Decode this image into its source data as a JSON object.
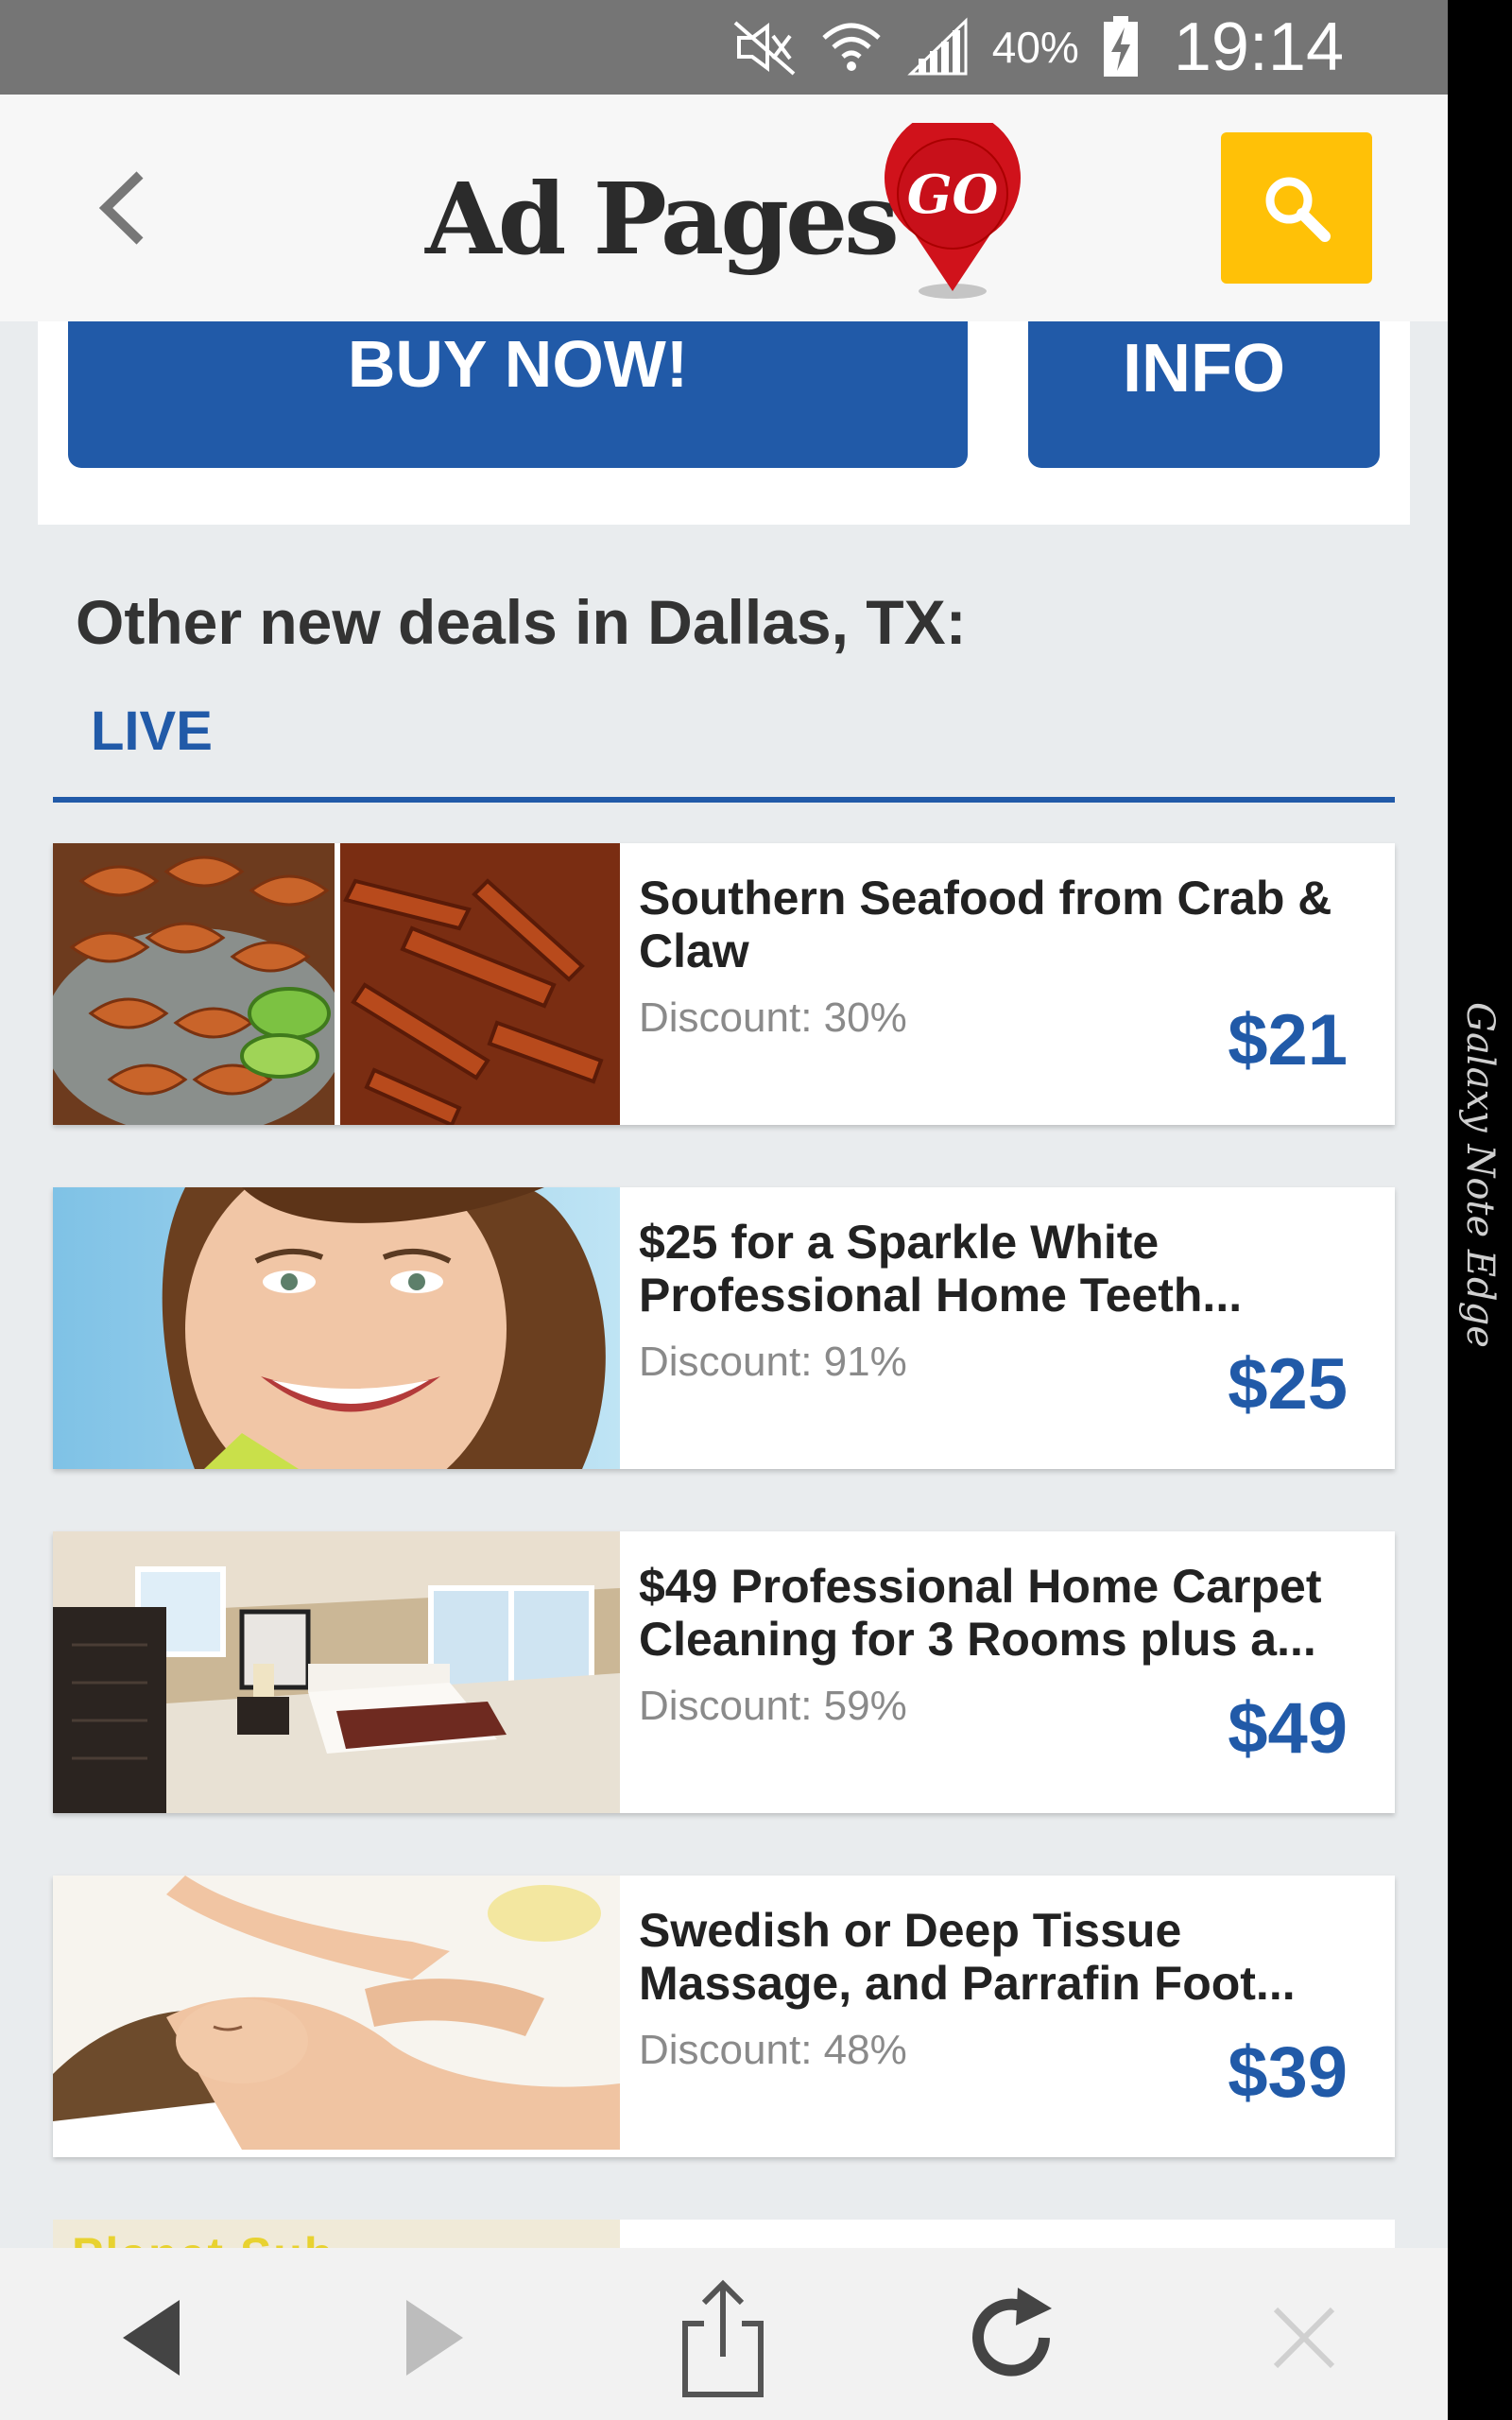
{
  "status_bar": {
    "battery_percent": "40%",
    "time": "19:14",
    "icons": [
      "mute-icon",
      "wifi-icon",
      "signal-icon",
      "battery-charging-icon"
    ]
  },
  "header": {
    "back_icon": "chevron-left-icon",
    "logo_text": "Ad Pages",
    "logo_badge": "GO",
    "search_icon": "search-icon",
    "search_button_color": "#ffc107"
  },
  "top_card": {
    "buy_label": "BUY NOW!",
    "info_label": "INFO"
  },
  "section": {
    "title": "Other new deals in Dallas, TX:",
    "tab_label": "LIVE"
  },
  "deals": [
    {
      "title": "Southern Seafood from Crab & Claw",
      "discount": "Discount: 30%",
      "price": "$21"
    },
    {
      "title": "$25 for a Sparkle White Professional Home Teeth...",
      "discount": "Discount: 91%",
      "price": "$25"
    },
    {
      "title": "$49 Professional Home Carpet Cleaning for 3 Rooms plus a...",
      "discount": "Discount: 59%",
      "price": "$49"
    },
    {
      "title": "Swedish or Deep Tissue Massage, and Parrafin Foot...",
      "discount": "Discount: 48%",
      "price": "$39"
    }
  ],
  "partial_deal": {
    "image_text": "Planet Sub"
  },
  "bottom_bar": {
    "icons": [
      "back-arrow-icon",
      "forward-arrow-icon",
      "share-icon",
      "reload-icon",
      "close-icon"
    ]
  },
  "device_label": "Galaxy Note Edge",
  "colors": {
    "accent": "#215aa8",
    "price": "#215aa8",
    "status_bar": "#757575"
  }
}
